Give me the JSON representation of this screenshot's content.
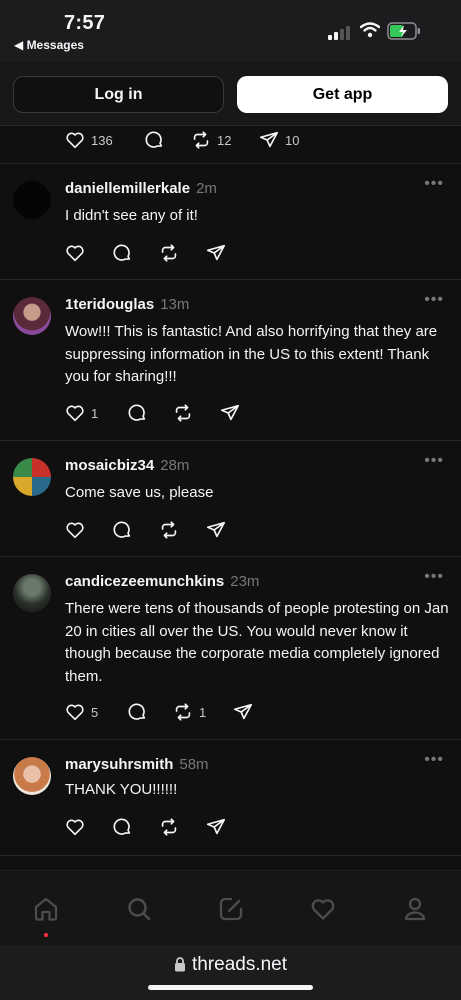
{
  "status_bar": {
    "time": "7:57",
    "back_label": "◀ Messages"
  },
  "header": {
    "login_label": "Log in",
    "getapp_label": "Get app"
  },
  "top_post_actions": {
    "likes": "136",
    "reposts": "12",
    "shares": "10"
  },
  "posts": [
    {
      "username": "daniellemillerkale",
      "time": "2m",
      "text": "I didn't see any of it!",
      "likes": "",
      "reposts": ""
    },
    {
      "username": "1teridouglas",
      "time": "13m",
      "text": "Wow!!! This is fantastic! And also horrifying that they are suppressing information in the US to this extent! Thank you for sharing!!!",
      "likes": "1",
      "reposts": ""
    },
    {
      "username": "mosaicbiz34",
      "time": "28m",
      "text": "Come save us, please",
      "likes": "",
      "reposts": ""
    },
    {
      "username": "candicezeemunchkins",
      "time": "23m",
      "text": "There were tens of thousands of people protesting on Jan 20 in cities all over the US. You would never know it though because the corporate media completely ignored them.",
      "likes": "5",
      "reposts": "1"
    },
    {
      "username": "marysuhrsmith",
      "time": "58m",
      "text": "THANK YOU!!!!!!",
      "likes": "",
      "reposts": ""
    }
  ],
  "browser": {
    "url": "threads.net"
  },
  "icons": [
    "heart-icon",
    "comment-icon",
    "repost-icon",
    "share-icon",
    "home-icon",
    "search-icon",
    "compose-icon",
    "activity-icon",
    "profile-icon",
    "lock-icon"
  ],
  "colors": {
    "background": "#101010",
    "muted": "#777777",
    "notification": "#ff3040"
  }
}
